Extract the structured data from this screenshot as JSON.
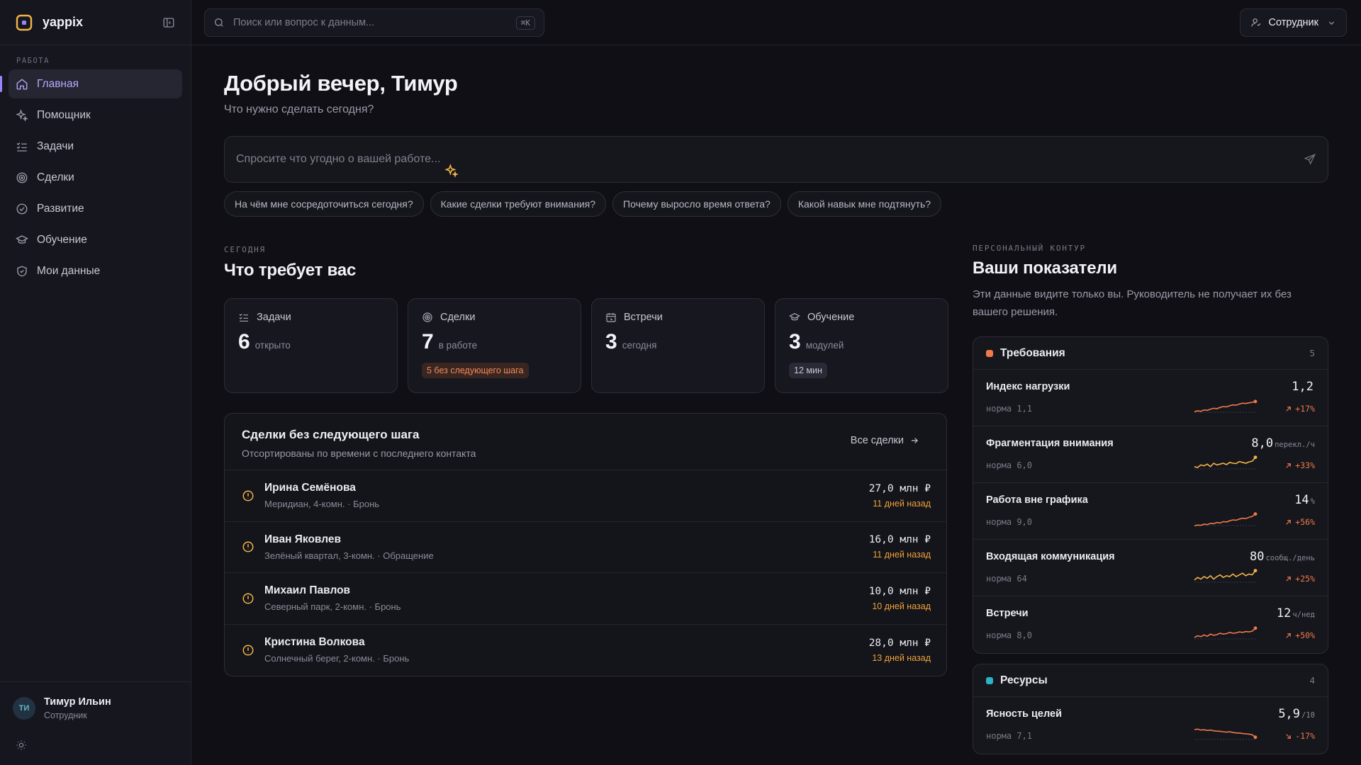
{
  "app": {
    "name": "yappix"
  },
  "sidebar": {
    "section_label": "РАБОТА",
    "items": [
      {
        "label": "Главная",
        "icon": "home-icon"
      },
      {
        "label": "Помощник",
        "icon": "sparkles-icon"
      },
      {
        "label": "Задачи",
        "icon": "list-checks-icon"
      },
      {
        "label": "Сделки",
        "icon": "target-icon"
      },
      {
        "label": "Развитие",
        "icon": "circle-check-icon"
      },
      {
        "label": "Обучение",
        "icon": "graduation-cap-icon"
      },
      {
        "label": "Мои данные",
        "icon": "shield-icon"
      }
    ],
    "user": {
      "initials": "ТИ",
      "name": "Тимур Ильин",
      "role": "Сотрудник"
    }
  },
  "topbar": {
    "search_placeholder": "Поиск или вопрос к данным...",
    "shortcut": "⌘K",
    "role_label": "Сотрудник"
  },
  "greeting": {
    "title": "Добрый вечер, Тимур",
    "subtitle": "Что нужно сделать сегодня?"
  },
  "ask": {
    "placeholder": "Спросите что угодно о вашей работе..."
  },
  "suggestions": [
    "На чём мне сосредоточиться сегодня?",
    "Какие сделки требуют внимания?",
    "Почему выросло время ответа?",
    "Какой навык мне подтянуть?"
  ],
  "today": {
    "eyebrow": "СЕГОДНЯ",
    "title": "Что требует вас",
    "cards": [
      {
        "label": "Задачи",
        "value": "6",
        "unit": "открыто",
        "pill": ""
      },
      {
        "label": "Сделки",
        "value": "7",
        "unit": "в работе",
        "pill": "5 без следующего шага"
      },
      {
        "label": "Встречи",
        "value": "3",
        "unit": "сегодня",
        "pill": ""
      },
      {
        "label": "Обучение",
        "value": "3",
        "unit": "модулей",
        "pill": "12 мин"
      }
    ]
  },
  "deals": {
    "title": "Сделки без следующего шага",
    "subtitle": "Отсортированы по времени с последнего контакта",
    "all_link": "Все сделки",
    "rows": [
      {
        "name": "Ирина Семёнова",
        "meta": "Меридиан, 4-комн. · Бронь",
        "amount": "27,0 млн ₽",
        "ago": "11 дней назад"
      },
      {
        "name": "Иван Яковлев",
        "meta": "Зелёный квартал, 3-комн. · Обращение",
        "amount": "16,0 млн ₽",
        "ago": "11 дней назад"
      },
      {
        "name": "Михаил Павлов",
        "meta": "Северный парк, 2-комн. · Бронь",
        "amount": "10,0 млн ₽",
        "ago": "10 дней назад"
      },
      {
        "name": "Кристина Волкова",
        "meta": "Солнечный берег, 2-комн. · Бронь",
        "amount": "28,0 млн ₽",
        "ago": "13 дней назад"
      }
    ]
  },
  "metrics": {
    "eyebrow": "ПЕРСОНАЛЬНЫЙ КОНТУР",
    "title": "Ваши показатели",
    "note": "Эти данные видите только вы. Руководитель не получает их без вашего решения.",
    "colors": {
      "demands": "#f07a4a",
      "resources": "#2bb3c8",
      "up": "#f07a4a",
      "spark_alt": "#f2b447"
    },
    "demands": {
      "title": "Требования",
      "count": "5",
      "items": [
        {
          "name": "Индекс нагрузки",
          "norm": "норма 1,1",
          "value": "1,2",
          "unit": "",
          "trend": "+17%",
          "spark": [
            0.2,
            0.25,
            0.22,
            0.3,
            0.28,
            0.35,
            0.4,
            0.38,
            0.45,
            0.5,
            0.48,
            0.55,
            0.6,
            0.58,
            0.65,
            0.7,
            0.68,
            0.72,
            0.75,
            0.8
          ]
        },
        {
          "name": "Фрагментация внимания",
          "norm": "норма 6,0",
          "value": "8,0",
          "unit": "перекл./ч",
          "trend": "+33%",
          "spark": [
            0.3,
            0.25,
            0.4,
            0.35,
            0.45,
            0.3,
            0.5,
            0.4,
            0.45,
            0.5,
            0.42,
            0.55,
            0.5,
            0.48,
            0.6,
            0.55,
            0.5,
            0.58,
            0.62,
            0.85
          ]
        },
        {
          "name": "Работа вне графика",
          "norm": "норма 9,0",
          "value": "14",
          "unit": "%",
          "trend": "+56%",
          "spark": [
            0.15,
            0.2,
            0.18,
            0.25,
            0.22,
            0.3,
            0.28,
            0.35,
            0.32,
            0.4,
            0.38,
            0.45,
            0.5,
            0.48,
            0.55,
            0.6,
            0.58,
            0.65,
            0.7,
            0.85
          ]
        },
        {
          "name": "Входящая коммуникация",
          "norm": "норма 64",
          "value": "80",
          "unit": "сообщ./день",
          "trend": "+25%",
          "spark": [
            0.3,
            0.45,
            0.35,
            0.5,
            0.4,
            0.55,
            0.35,
            0.5,
            0.6,
            0.45,
            0.55,
            0.5,
            0.65,
            0.5,
            0.6,
            0.7,
            0.55,
            0.65,
            0.6,
            0.85
          ]
        },
        {
          "name": "Встречи",
          "norm": "норма 8,0",
          "value": "12",
          "unit": "ч/нед",
          "trend": "+50%",
          "spark": [
            0.25,
            0.35,
            0.3,
            0.4,
            0.32,
            0.45,
            0.38,
            0.42,
            0.5,
            0.45,
            0.48,
            0.55,
            0.5,
            0.52,
            0.58,
            0.55,
            0.6,
            0.58,
            0.62,
            0.8
          ]
        }
      ]
    },
    "resources": {
      "title": "Ресурсы",
      "count": "4",
      "items": [
        {
          "name": "Ясность целей",
          "norm": "норма 7,1",
          "value": "5,9",
          "unit": "/10",
          "trend": "-17%",
          "spark": [
            0.75,
            0.78,
            0.72,
            0.74,
            0.7,
            0.72,
            0.68,
            0.66,
            0.65,
            0.62,
            0.6,
            0.62,
            0.58,
            0.55,
            0.55,
            0.52,
            0.5,
            0.48,
            0.45,
            0.3
          ]
        }
      ]
    }
  }
}
